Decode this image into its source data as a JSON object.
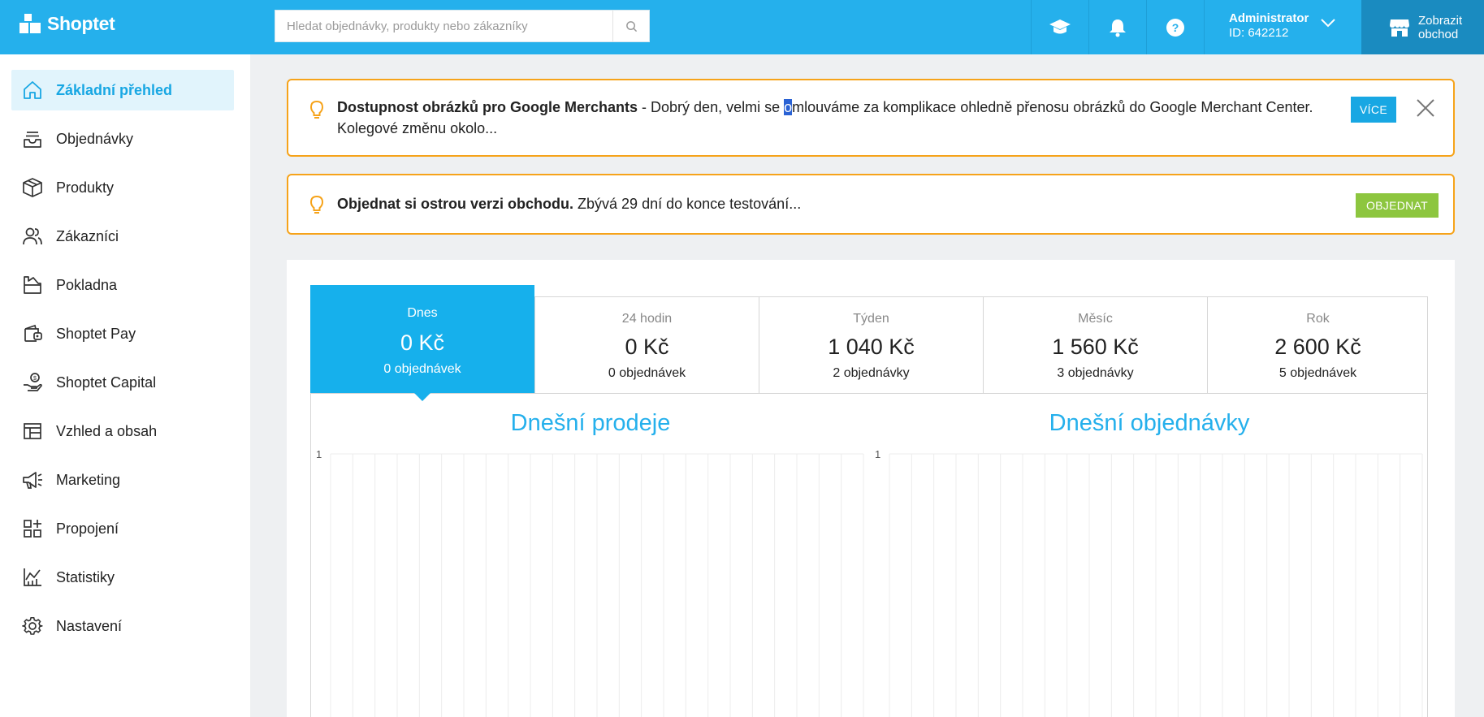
{
  "header": {
    "logo": "Shoptet",
    "search_placeholder": "Hledat objednávky, produkty nebo zákazníky",
    "user_name": "Administrator",
    "user_id": "ID: 642212",
    "store_line1": "Zobrazit",
    "store_line2": "obchod"
  },
  "sidebar": {
    "items": [
      {
        "label": "Základní přehled",
        "icon": "home-icon"
      },
      {
        "label": "Objednávky",
        "icon": "inbox-icon"
      },
      {
        "label": "Produkty",
        "icon": "box-icon"
      },
      {
        "label": "Zákazníci",
        "icon": "users-icon"
      },
      {
        "label": "Pokladna",
        "icon": "cash-register-icon"
      },
      {
        "label": "Shoptet Pay",
        "icon": "wallet-icon"
      },
      {
        "label": "Shoptet Capital",
        "icon": "hand-coin-icon"
      },
      {
        "label": "Vzhled a obsah",
        "icon": "layout-icon"
      },
      {
        "label": "Marketing",
        "icon": "megaphone-icon"
      },
      {
        "label": "Propojení",
        "icon": "apps-plus-icon"
      },
      {
        "label": "Statistiky",
        "icon": "chart-icon"
      },
      {
        "label": "Nastavení",
        "icon": "gear-icon"
      }
    ]
  },
  "alerts": {
    "google": {
      "title": "Dostupnost obrázků pro Google Merchants",
      "text_before": " - Dobrý den, velmi se ",
      "highlight": "o",
      "text_after": "mlouváme za komplikace ohledně přenosu obrázků do Google Merchant Center. Kolegové změnu okolo...",
      "button": "VÍCE"
    },
    "order": {
      "title": "Objednat si ostrou verzi obchodu.",
      "text": " Zbývá 29 dní do konce testování...",
      "button": "OBJEDNAT"
    }
  },
  "stats": {
    "tabs": [
      {
        "title": "Dnes",
        "value": "0 Kč",
        "count": "0 objednávek"
      },
      {
        "title": "24 hodin",
        "value": "0 Kč",
        "count": "0 objednávek"
      },
      {
        "title": "Týden",
        "value": "1 040 Kč",
        "count": "2 objednávky"
      },
      {
        "title": "Měsíc",
        "value": "1 560 Kč",
        "count": "3 objednávky"
      },
      {
        "title": "Rok",
        "value": "2 600 Kč",
        "count": "5 objednávek"
      }
    ]
  },
  "chart_data": [
    {
      "type": "line",
      "title": "Dnešní prodeje",
      "ylim": [
        0,
        1
      ],
      "y_tick_labels": [
        "1"
      ],
      "x": [],
      "values": [],
      "grid": true
    },
    {
      "type": "line",
      "title": "Dnešní objednávky",
      "ylim": [
        0,
        1
      ],
      "y_tick_labels": [
        "1"
      ],
      "x": [],
      "values": [],
      "grid": true
    }
  ],
  "colors": {
    "primary": "#25b0ec",
    "accent_orange": "#f6a31a",
    "green": "#8dc63f"
  }
}
